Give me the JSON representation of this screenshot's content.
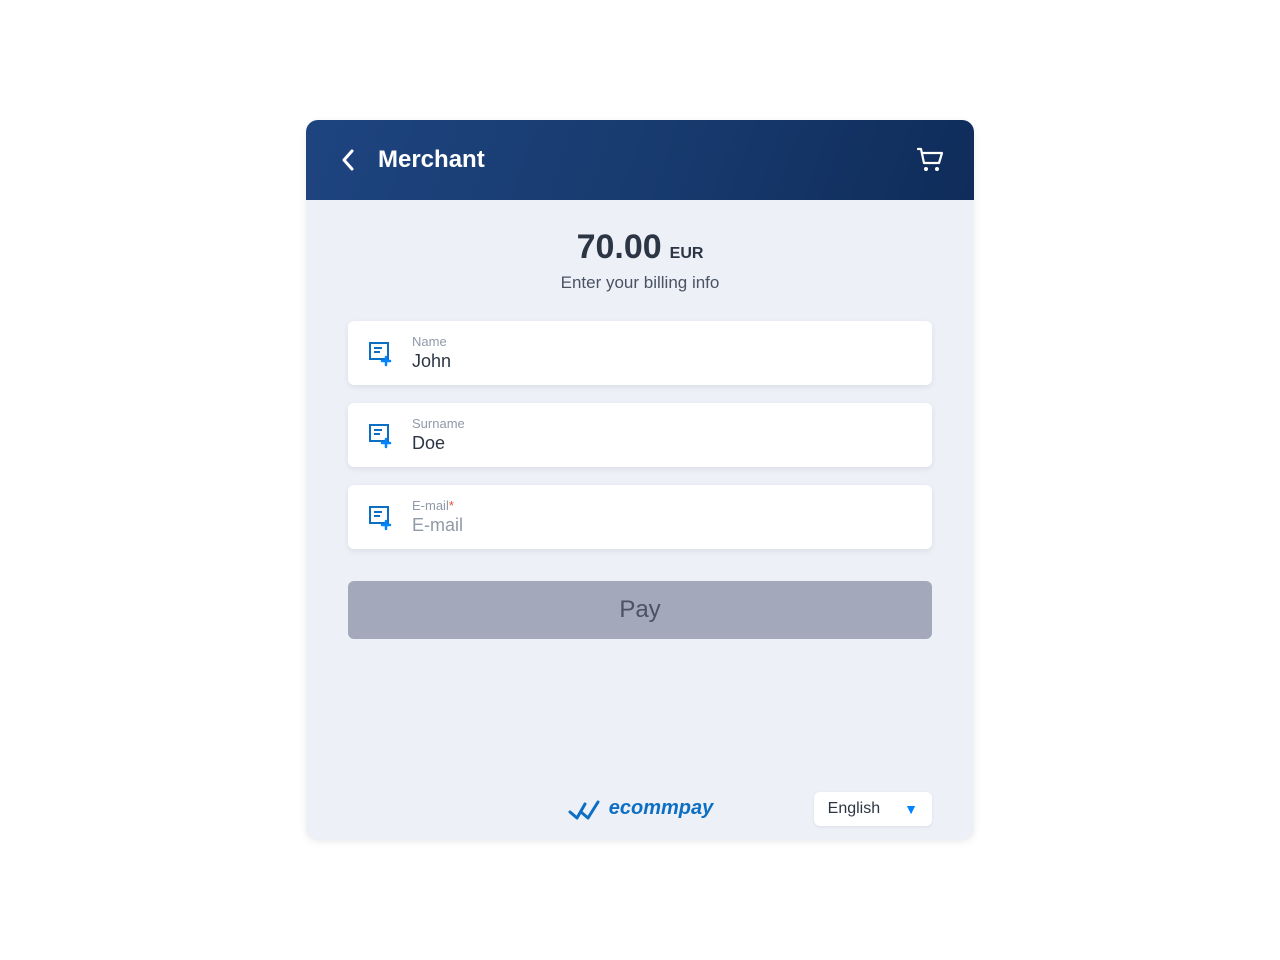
{
  "header": {
    "title": "Merchant"
  },
  "amount": {
    "value": "70.00",
    "currency": "EUR",
    "subtitle": "Enter your billing info"
  },
  "fields": {
    "name": {
      "label": "Name",
      "value": "John"
    },
    "surname": {
      "label": "Surname",
      "value": "Doe"
    },
    "email": {
      "label": "E-mail",
      "placeholder": "E-mail",
      "value": "",
      "required": true
    }
  },
  "actions": {
    "pay_label": "Pay"
  },
  "footer": {
    "brand": "ecommpay",
    "language": "English"
  }
}
